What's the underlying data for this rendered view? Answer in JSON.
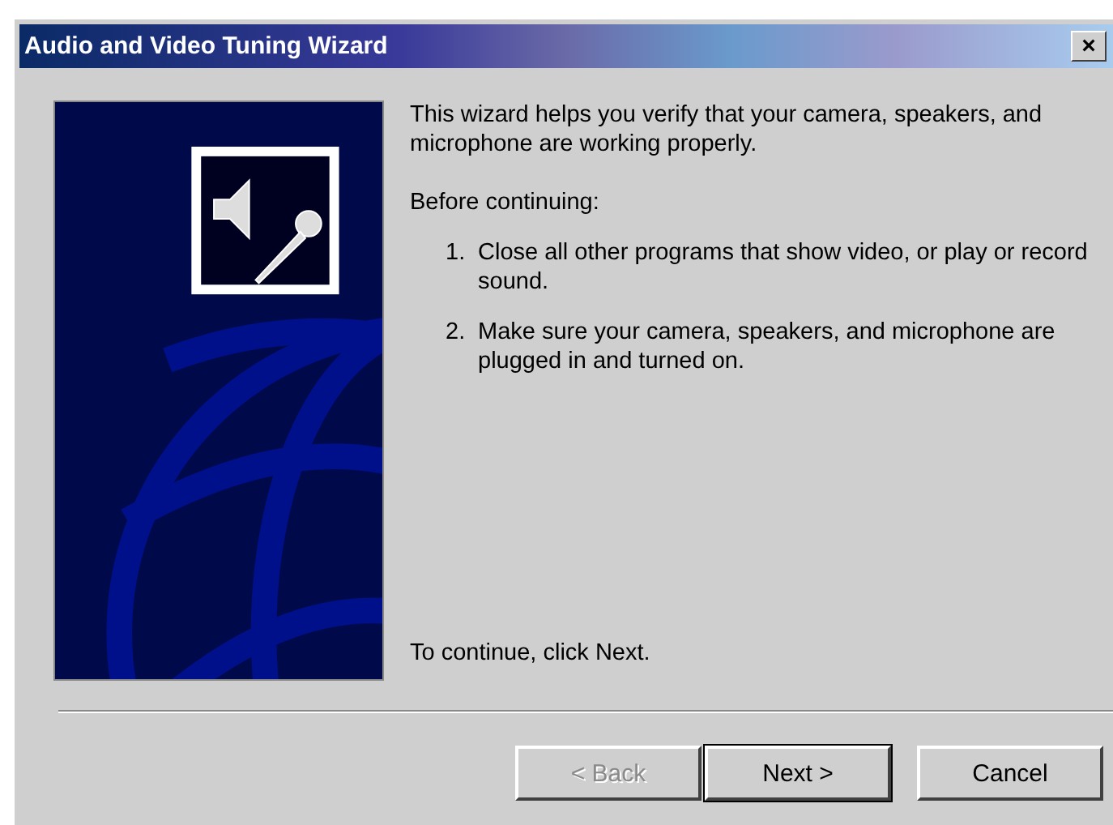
{
  "window": {
    "title": "Audio and Video Tuning Wizard",
    "close": "×"
  },
  "intro": "This wizard helps you verify that your camera, speakers, and microphone are working properly.",
  "before": "Before continuing:",
  "steps": [
    {
      "number": "1.",
      "text": "Close all other programs that show video, or play or record sound."
    },
    {
      "number": "2.",
      "text": "Make sure your camera, speakers, and microphone are plugged in and turned on."
    }
  ],
  "footer": "To continue, click Next.",
  "buttons": [
    {
      "label": "< Back",
      "disabled": true,
      "default": false
    },
    {
      "label": "Next >",
      "disabled": false,
      "default": true
    },
    {
      "label": "Cancel",
      "disabled": false,
      "default": false
    }
  ]
}
